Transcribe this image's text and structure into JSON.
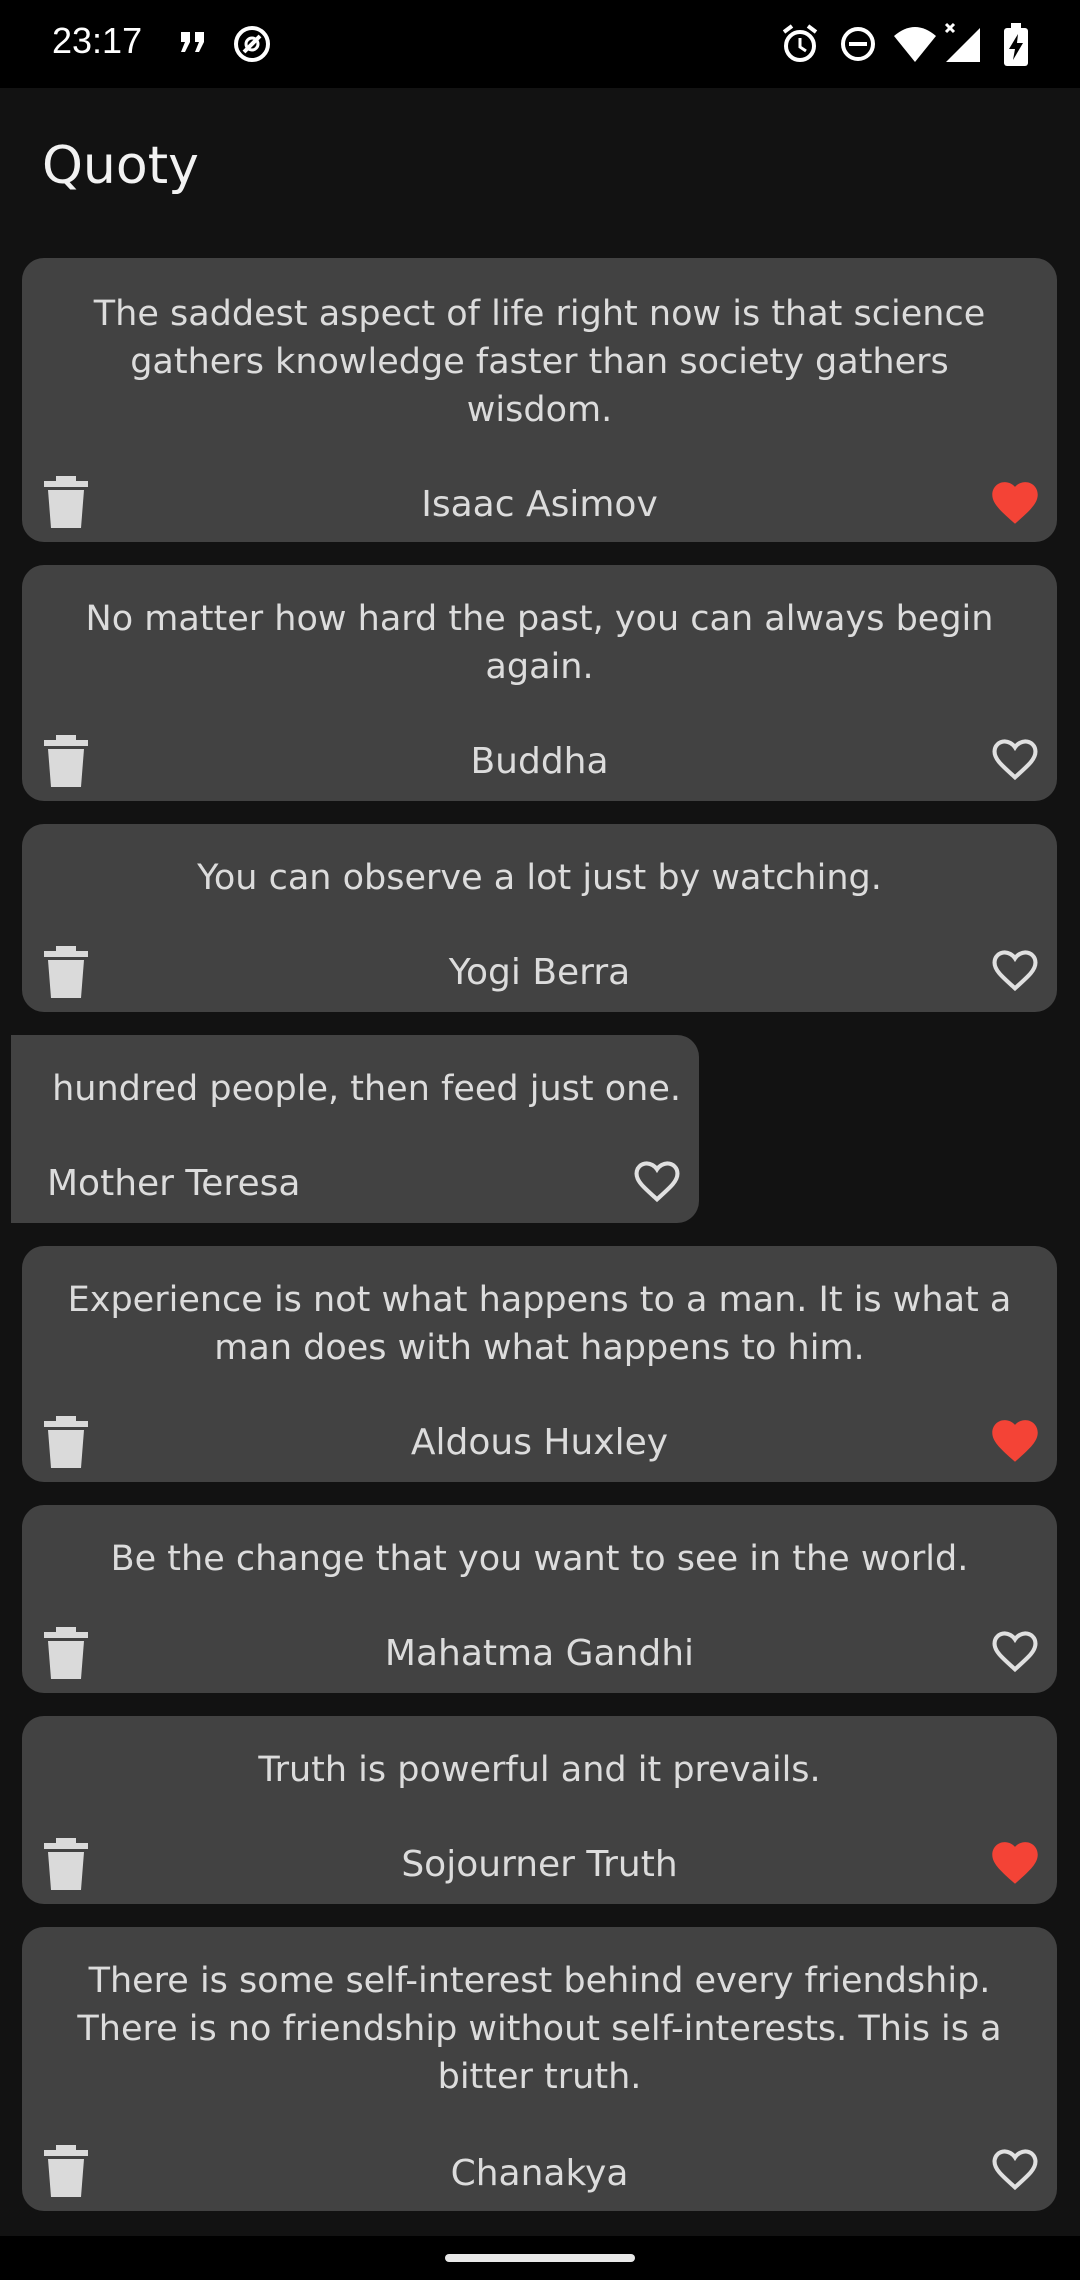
{
  "status": {
    "time": "23:17"
  },
  "app": {
    "title": "Quoty"
  },
  "quotes": [
    {
      "text": "The saddest aspect of life right now is that science gathers knowledge faster than society gathers wisdom.",
      "author": "Isaac Asimov",
      "liked": true
    },
    {
      "text": "No matter how hard the past, you can always begin again.",
      "author": "Buddha",
      "liked": false
    },
    {
      "text": "You can observe a lot just by watching.",
      "author": "Yogi Berra",
      "liked": false
    },
    {
      "text": "hundred people, then feed just one.",
      "author": "Mother Teresa",
      "liked": false
    },
    {
      "text": "Experience is not what happens to a man. It is what a man does with what happens to him.",
      "author": "Aldous Huxley",
      "liked": true
    },
    {
      "text": "Be the change that you want to see in the world.",
      "author": "Mahatma Gandhi",
      "liked": false
    },
    {
      "text": "Truth is powerful and it prevails.",
      "author": "Sojourner Truth",
      "liked": true
    },
    {
      "text": "There is some self-interest behind every friendship. There is no friendship without self-interests. This is a bitter truth.",
      "author": "Chanakya",
      "liked": false
    }
  ],
  "colors": {
    "background": "#121212",
    "card": "#424242",
    "heart_liked": "#f44336",
    "heart_outline": "#e0e0e0"
  }
}
